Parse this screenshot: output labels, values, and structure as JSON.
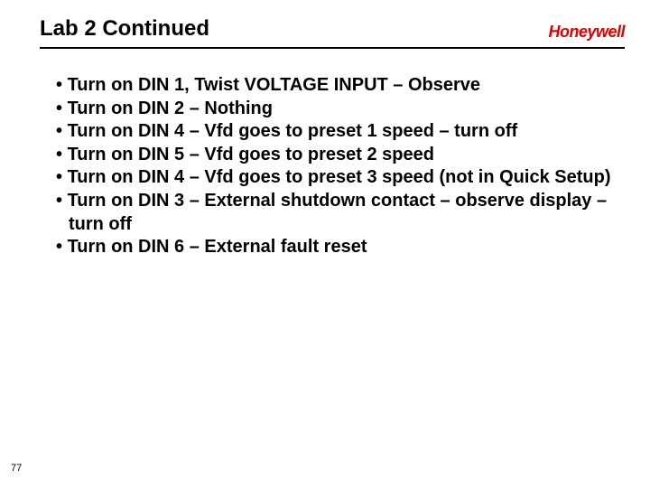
{
  "header": {
    "title": "Lab 2 Continued",
    "brand": "Honeywell"
  },
  "bullets": [
    "Turn on DIN 1, Twist VOLTAGE INPUT – Observe",
    "Turn on DIN 2 – Nothing",
    "Turn on DIN 4 – Vfd goes to preset 1 speed – turn off",
    "Turn on DIN 5 – Vfd goes to preset 2 speed",
    "Turn on DIN 4 – Vfd goes to preset 3 speed (not in Quick Setup)",
    "Turn on DIN 3 – External shutdown contact – observe display – turn off",
    "Turn on DIN 6 – External fault reset"
  ],
  "pagenum": "77"
}
